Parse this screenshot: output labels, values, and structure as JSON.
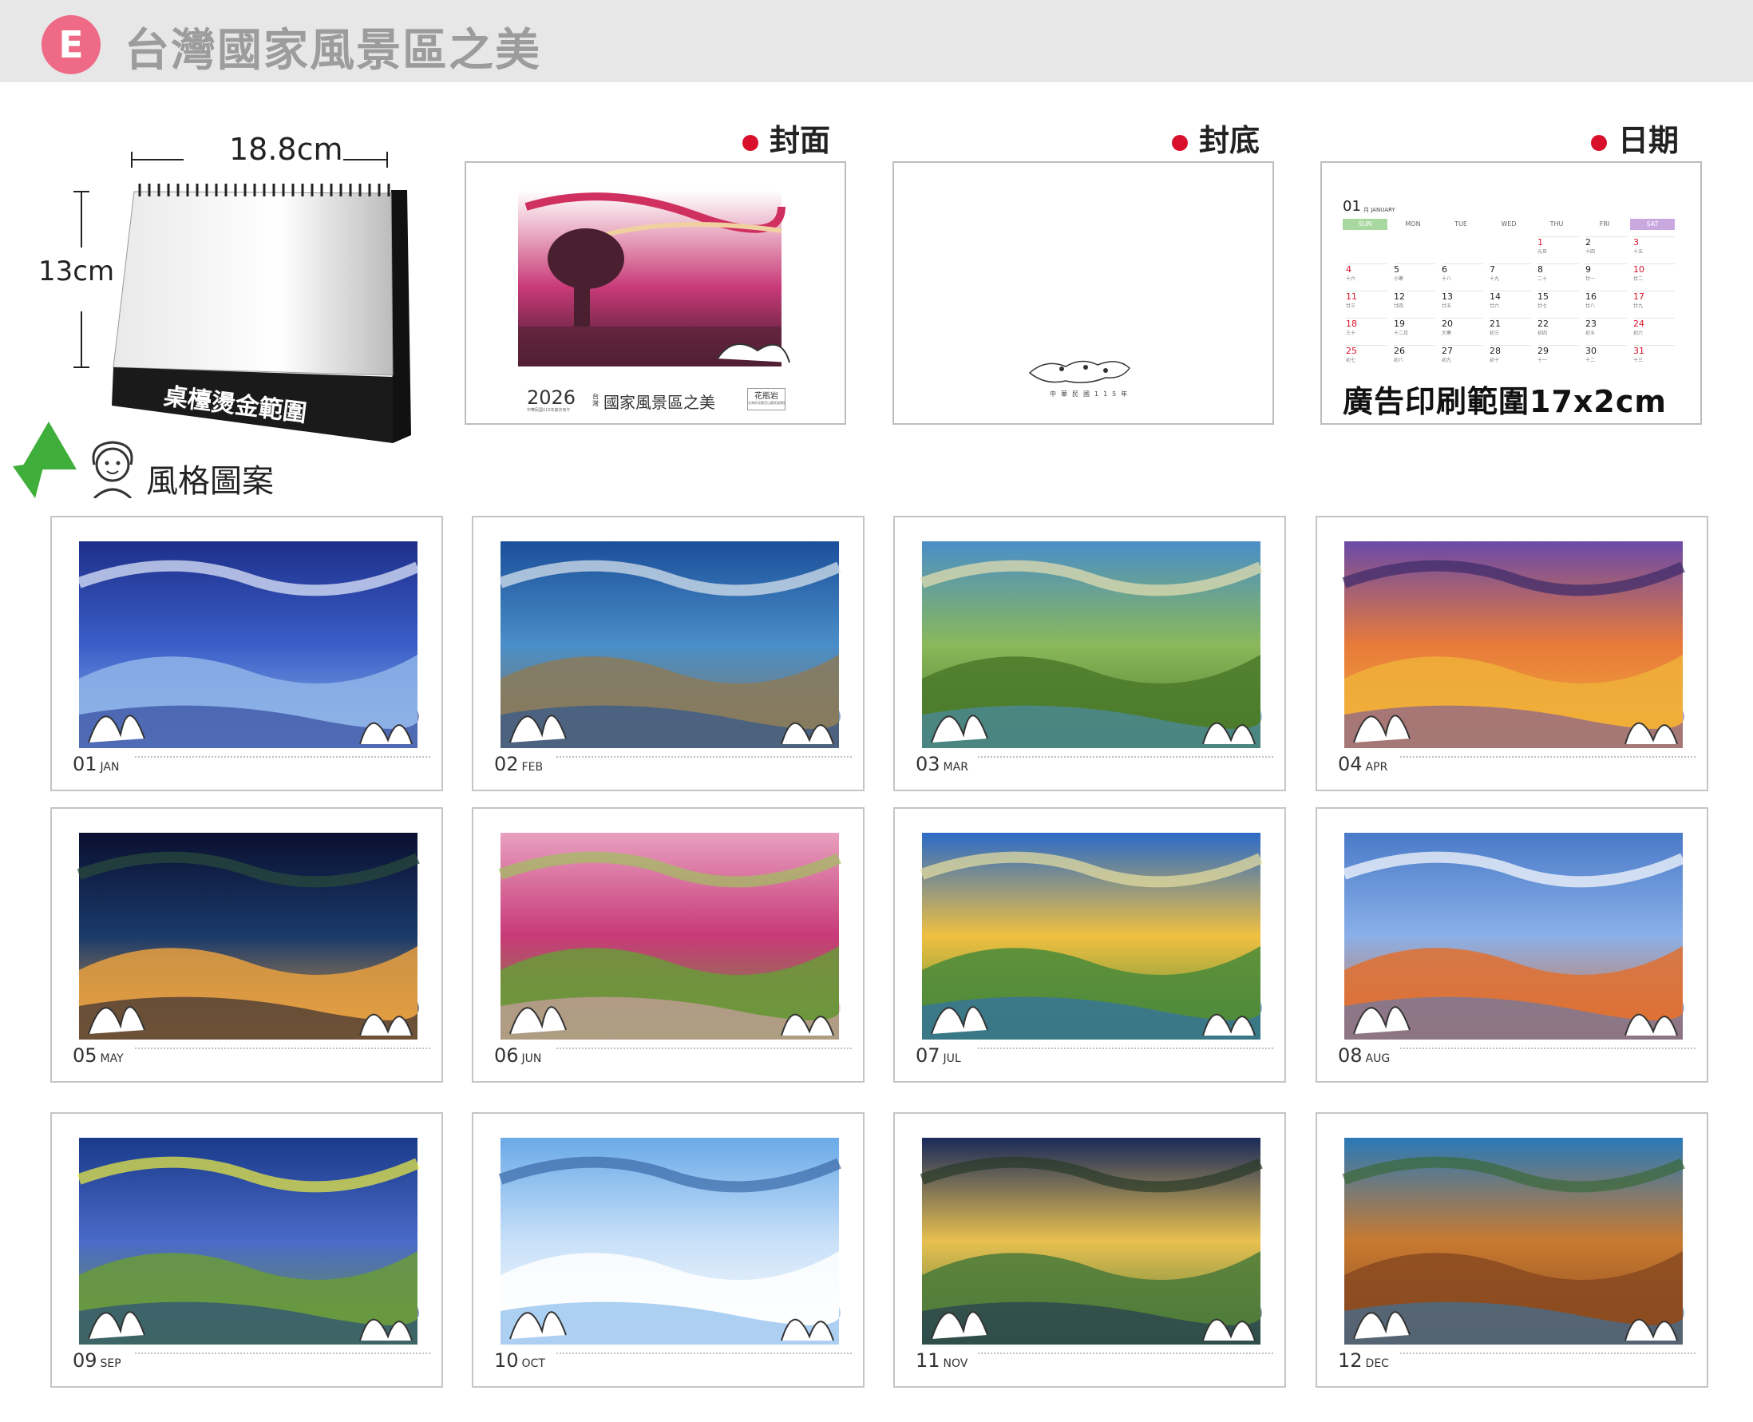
{
  "header": {
    "badge": "E",
    "title": "台灣國家風景區之美"
  },
  "sections": {
    "front_cover": "封面",
    "back_cover": "封底",
    "date_page": "日期"
  },
  "desk_mockup": {
    "width_label": "18.8cm",
    "height_label": "13cm",
    "stamp_area": "桌檯燙金範圍"
  },
  "style_label": "風格圖案",
  "front_cover": {
    "year": "2026",
    "title": "國家風景區之美",
    "title_prefix": "台灣",
    "sub_small": "中華民國115年歲次丙午",
    "badge": "花瓶岩",
    "badge_sub": "北海岸及觀音山國家風景區"
  },
  "back_cover": {
    "text": "中華民國115年"
  },
  "date_page": {
    "month_num": "01",
    "month_small": "月 JANUARY",
    "weekdays": [
      "SUN",
      "MON",
      "TUE",
      "WED",
      "THU",
      "FRI",
      "SAT"
    ],
    "ad_text": "廣告印刷範圍17x2cm",
    "rows": [
      [
        "",
        "",
        "",
        "",
        "1",
        "2",
        "3"
      ],
      [
        "4",
        "5",
        "6",
        "7",
        "8",
        "9",
        "10"
      ],
      [
        "11",
        "12",
        "13",
        "14",
        "15",
        "16",
        "17"
      ],
      [
        "18",
        "19",
        "20",
        "21",
        "22",
        "23",
        "24"
      ],
      [
        "25",
        "26",
        "27",
        "28",
        "29",
        "30",
        "31"
      ]
    ],
    "lunar": [
      [
        "",
        "",
        "",
        "",
        "元旦",
        "十四",
        "十五"
      ],
      [
        "十六",
        "小寒",
        "十八",
        "十九",
        "二十",
        "廿一",
        "廿二"
      ],
      [
        "廿三",
        "廿四",
        "廿五",
        "廿六",
        "廿七",
        "廿八",
        "廿九"
      ],
      [
        "三十",
        "十二月",
        "大寒",
        "初三",
        "初四",
        "初五",
        "初六"
      ],
      [
        "初七",
        "初八",
        "初九",
        "初十",
        "十一",
        "十二",
        "十三"
      ]
    ]
  },
  "months": [
    {
      "num": "01",
      "abbr": "JAN"
    },
    {
      "num": "02",
      "abbr": "FEB"
    },
    {
      "num": "03",
      "abbr": "MAR"
    },
    {
      "num": "04",
      "abbr": "APR"
    },
    {
      "num": "05",
      "abbr": "MAY"
    },
    {
      "num": "06",
      "abbr": "JUN"
    },
    {
      "num": "07",
      "abbr": "JUL"
    },
    {
      "num": "08",
      "abbr": "AUG"
    },
    {
      "num": "09",
      "abbr": "SEP"
    },
    {
      "num": "10",
      "abbr": "OCT"
    },
    {
      "num": "11",
      "abbr": "NOV"
    },
    {
      "num": "12",
      "abbr": "DEC"
    }
  ],
  "colors": {
    "badge": "#ee6a86",
    "header_bg": "#e7e7e7",
    "title_gray": "#9c9c9c",
    "dot_red": "#d8102b",
    "weekend_red": "#d8102b",
    "sun_green": "#a8d8a0",
    "sat_purple": "#c9a8e0"
  }
}
